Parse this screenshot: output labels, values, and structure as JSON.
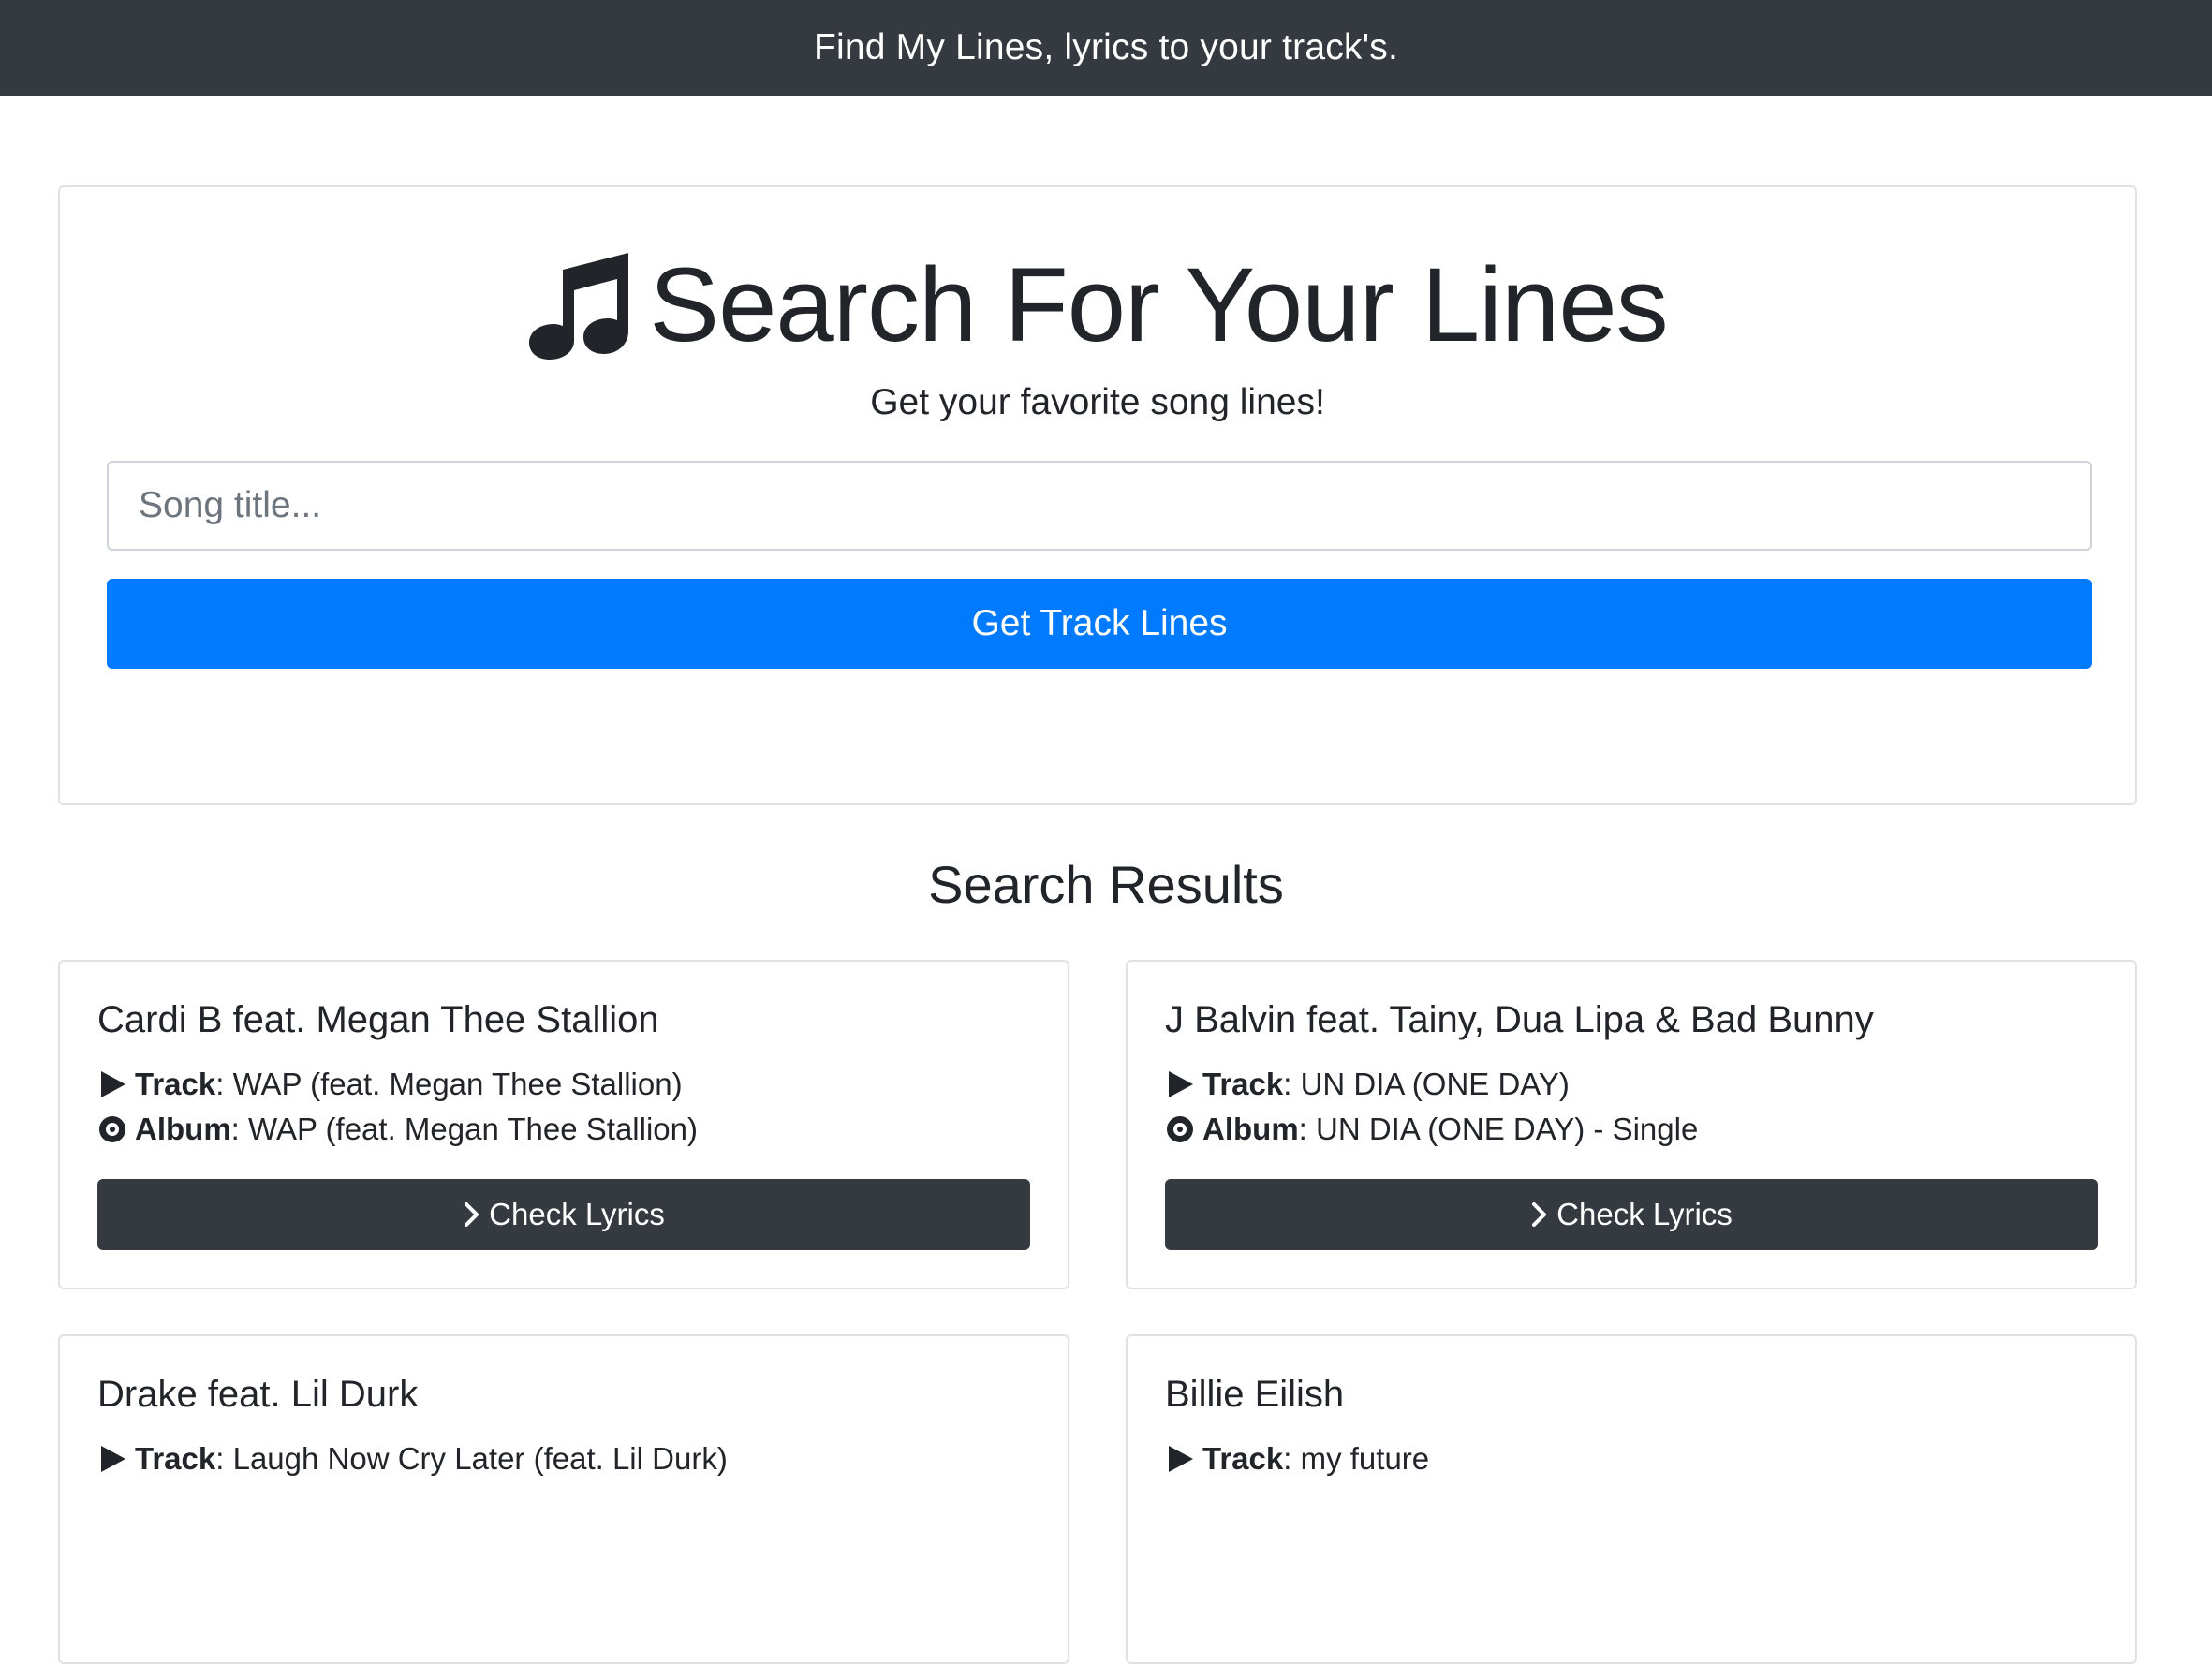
{
  "header": {
    "title": "Find My Lines, lyrics to your track's."
  },
  "search": {
    "heading": "Search For Your Lines",
    "subheading": "Get your favorite song lines!",
    "input_placeholder": "Song title...",
    "input_value": "",
    "button_label": "Get Track Lines"
  },
  "results": {
    "heading": "Search Results",
    "track_label": "Track",
    "album_label": "Album",
    "button_label": "Check Lyrics",
    "items": [
      {
        "artist": "Cardi B feat. Megan Thee Stallion",
        "track": "WAP (feat. Megan Thee Stallion)",
        "album": "WAP (feat. Megan Thee Stallion)"
      },
      {
        "artist": "J Balvin feat. Tainy, Dua Lipa & Bad Bunny",
        "track": "UN DIA (ONE DAY)",
        "album": "UN DIA (ONE DAY) - Single"
      },
      {
        "artist": "Drake feat. Lil Durk",
        "track": "Laugh Now Cry Later (feat. Lil Durk)",
        "album": ""
      },
      {
        "artist": "Billie Eilish",
        "track": "my future",
        "album": ""
      }
    ]
  },
  "colors": {
    "navbar": "#343a40",
    "primary": "#007bff",
    "dark_button": "#343a40",
    "border": "#dfe1e4"
  },
  "icons": {
    "heading": "music-note-icon",
    "track": "play-icon",
    "album": "record-icon",
    "button": "chevron-right-icon"
  }
}
